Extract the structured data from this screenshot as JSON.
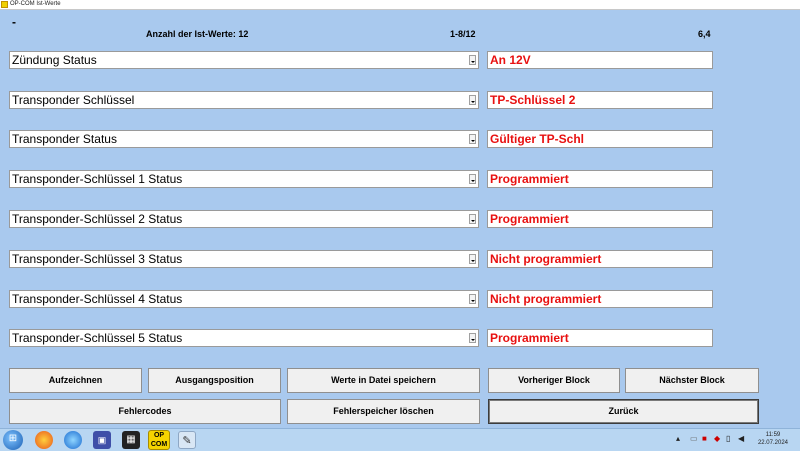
{
  "window": {
    "title": "OP-COM Ist-Werte"
  },
  "header": {
    "dash": "-",
    "count_label": "Anzahl der Ist-Werte: 12",
    "range": "1-8/12",
    "version": "6,4"
  },
  "rows": [
    {
      "label": "Zündung Status",
      "value": "An 12V"
    },
    {
      "label": "Transponder Schlüssel",
      "value": "TP-Schlüssel 2"
    },
    {
      "label": "Transponder Status",
      "value": "Gültiger TP-Schl"
    },
    {
      "label": "Transponder-Schlüssel 1 Status",
      "value": "Programmiert"
    },
    {
      "label": "Transponder-Schlüssel 2 Status",
      "value": "Programmiert"
    },
    {
      "label": "Transponder-Schlüssel 3 Status",
      "value": "Nicht programmiert"
    },
    {
      "label": "Transponder-Schlüssel 4 Status",
      "value": "Nicht programmiert"
    },
    {
      "label": "Transponder-Schlüssel 5 Status",
      "value": "Programmiert"
    }
  ],
  "buttons": {
    "record": "Aufzeichnen",
    "start_position": "Ausgangsposition",
    "save_to_file": "Werte in Datei speichern",
    "previous_block": "Vorheriger Block",
    "next_block": "Nächster Block",
    "fault_codes": "Fehlercodes",
    "clear_fault_memory": "Fehlerspeicher löschen",
    "back": "Zurück"
  },
  "taskbar": {
    "opcom_line1": "OP",
    "opcom_line2": "COM",
    "time": "11:59",
    "date": "22.07.2024"
  },
  "colors": {
    "background": "#a9c9ee",
    "value_text": "#e81010"
  },
  "icons": [
    "start-icon",
    "firefox-icon",
    "browser-icon",
    "save-icon",
    "apps-icon",
    "opcom-icon",
    "tool-icon"
  ]
}
